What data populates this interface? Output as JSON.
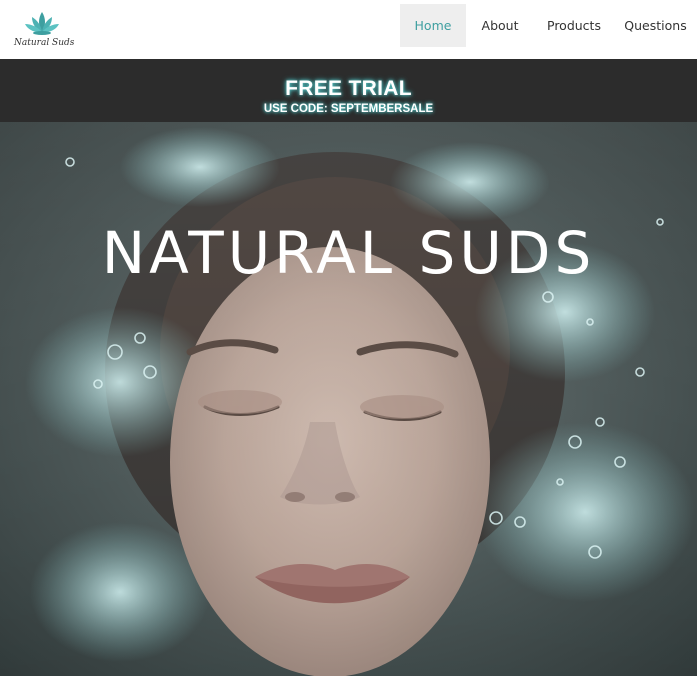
{
  "header": {
    "logo_text": "Natural Suds",
    "nav": {
      "home": "Home",
      "about": "About",
      "products": "Products",
      "questions": "Questions"
    },
    "active_item": "Home"
  },
  "promo": {
    "title": "FREE TRIAL",
    "code_line": "USE CODE: SEPTEMBERSALE"
  },
  "hero": {
    "title": "NATURAL SUDS"
  },
  "colors": {
    "accent": "#3e9fa0",
    "promo_bg": "#2c2c2c",
    "nav_active_bg": "#eeeeee"
  }
}
